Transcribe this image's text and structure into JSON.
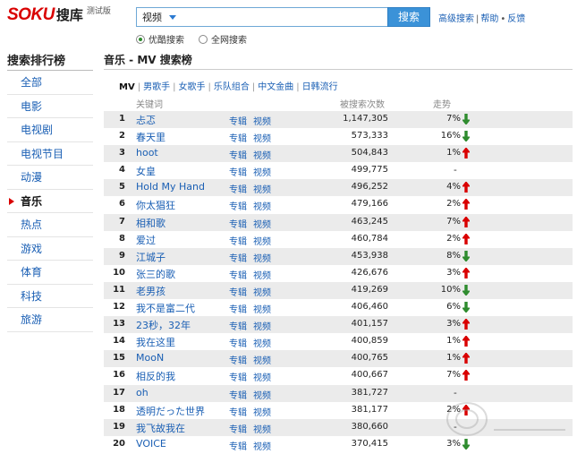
{
  "header": {
    "logo_text": "SOKU",
    "logo_cn": "搜库",
    "beta_label": "测试版",
    "search_category": "视频",
    "search_value": "",
    "search_button": "搜索",
    "links": [
      "高级搜索",
      "帮助",
      "反馈"
    ],
    "radio_options": [
      {
        "label": "优酷搜索",
        "checked": true
      },
      {
        "label": "全网搜索",
        "checked": false
      }
    ]
  },
  "sidebar": {
    "title": "搜索排行榜",
    "items": [
      {
        "label": "全部",
        "active": false
      },
      {
        "label": "电影",
        "active": false
      },
      {
        "label": "电视剧",
        "active": false
      },
      {
        "label": "电视节目",
        "active": false
      },
      {
        "label": "动漫",
        "active": false
      },
      {
        "label": "音乐",
        "active": true
      },
      {
        "label": "热点",
        "active": false
      },
      {
        "label": "游戏",
        "active": false
      },
      {
        "label": "体育",
        "active": false
      },
      {
        "label": "科技",
        "active": false
      },
      {
        "label": "旅游",
        "active": false
      }
    ]
  },
  "main": {
    "title": "音乐 - MV 搜索榜",
    "subtabs": [
      {
        "label": "MV",
        "current": true
      },
      {
        "label": "男歌手",
        "current": false
      },
      {
        "label": "女歌手",
        "current": false
      },
      {
        "label": "乐队组合",
        "current": false
      },
      {
        "label": "中文金曲",
        "current": false
      },
      {
        "label": "日韩流行",
        "current": false
      }
    ],
    "columns": {
      "keyword": "关键词",
      "count": "被搜索次数",
      "trend": "走势"
    },
    "link_album": "专辑",
    "link_video": "视频",
    "rows": [
      {
        "rank": "1",
        "keyword": "忐忑",
        "count": "1,147,305",
        "pct": "7%",
        "trend": "down"
      },
      {
        "rank": "2",
        "keyword": "春天里",
        "count": "573,333",
        "pct": "16%",
        "trend": "down"
      },
      {
        "rank": "3",
        "keyword": "hoot",
        "count": "504,843",
        "pct": "1%",
        "trend": "up"
      },
      {
        "rank": "4",
        "keyword": "女皇",
        "count": "499,775",
        "pct": "",
        "trend": "none"
      },
      {
        "rank": "5",
        "keyword": "Hold My Hand",
        "count": "496,252",
        "pct": "4%",
        "trend": "up"
      },
      {
        "rank": "6",
        "keyword": "你太猖狂",
        "count": "479,166",
        "pct": "2%",
        "trend": "up"
      },
      {
        "rank": "7",
        "keyword": "相和歌",
        "count": "463,245",
        "pct": "7%",
        "trend": "up"
      },
      {
        "rank": "8",
        "keyword": "爱过",
        "count": "460,784",
        "pct": "2%",
        "trend": "up"
      },
      {
        "rank": "9",
        "keyword": "江城子",
        "count": "453,938",
        "pct": "8%",
        "trend": "down"
      },
      {
        "rank": "10",
        "keyword": "张三的歌",
        "count": "426,676",
        "pct": "3%",
        "trend": "up"
      },
      {
        "rank": "11",
        "keyword": "老男孩",
        "count": "419,269",
        "pct": "10%",
        "trend": "down"
      },
      {
        "rank": "12",
        "keyword": "我不是富二代",
        "count": "406,460",
        "pct": "6%",
        "trend": "down"
      },
      {
        "rank": "13",
        "keyword": "23秒，32年",
        "count": "401,157",
        "pct": "3%",
        "trend": "up"
      },
      {
        "rank": "14",
        "keyword": "我在这里",
        "count": "400,859",
        "pct": "1%",
        "trend": "up"
      },
      {
        "rank": "15",
        "keyword": "MooN",
        "count": "400,765",
        "pct": "1%",
        "trend": "up"
      },
      {
        "rank": "16",
        "keyword": "相反的我",
        "count": "400,667",
        "pct": "7%",
        "trend": "up"
      },
      {
        "rank": "17",
        "keyword": "oh",
        "count": "381,727",
        "pct": "",
        "trend": "none"
      },
      {
        "rank": "18",
        "keyword": "透明だった世界",
        "count": "381,177",
        "pct": "2%",
        "trend": "up"
      },
      {
        "rank": "19",
        "keyword": "我飞故我在",
        "count": "380,660",
        "pct": "",
        "trend": "none"
      },
      {
        "rank": "20",
        "keyword": "VOICE",
        "count": "370,415",
        "pct": "3%",
        "trend": "down"
      }
    ]
  },
  "colors": {
    "brand_red": "#d90000",
    "link_blue": "#1a5fb4",
    "up": "#d90000",
    "down": "#2f8c2f",
    "stripe": "#ebebeb"
  }
}
